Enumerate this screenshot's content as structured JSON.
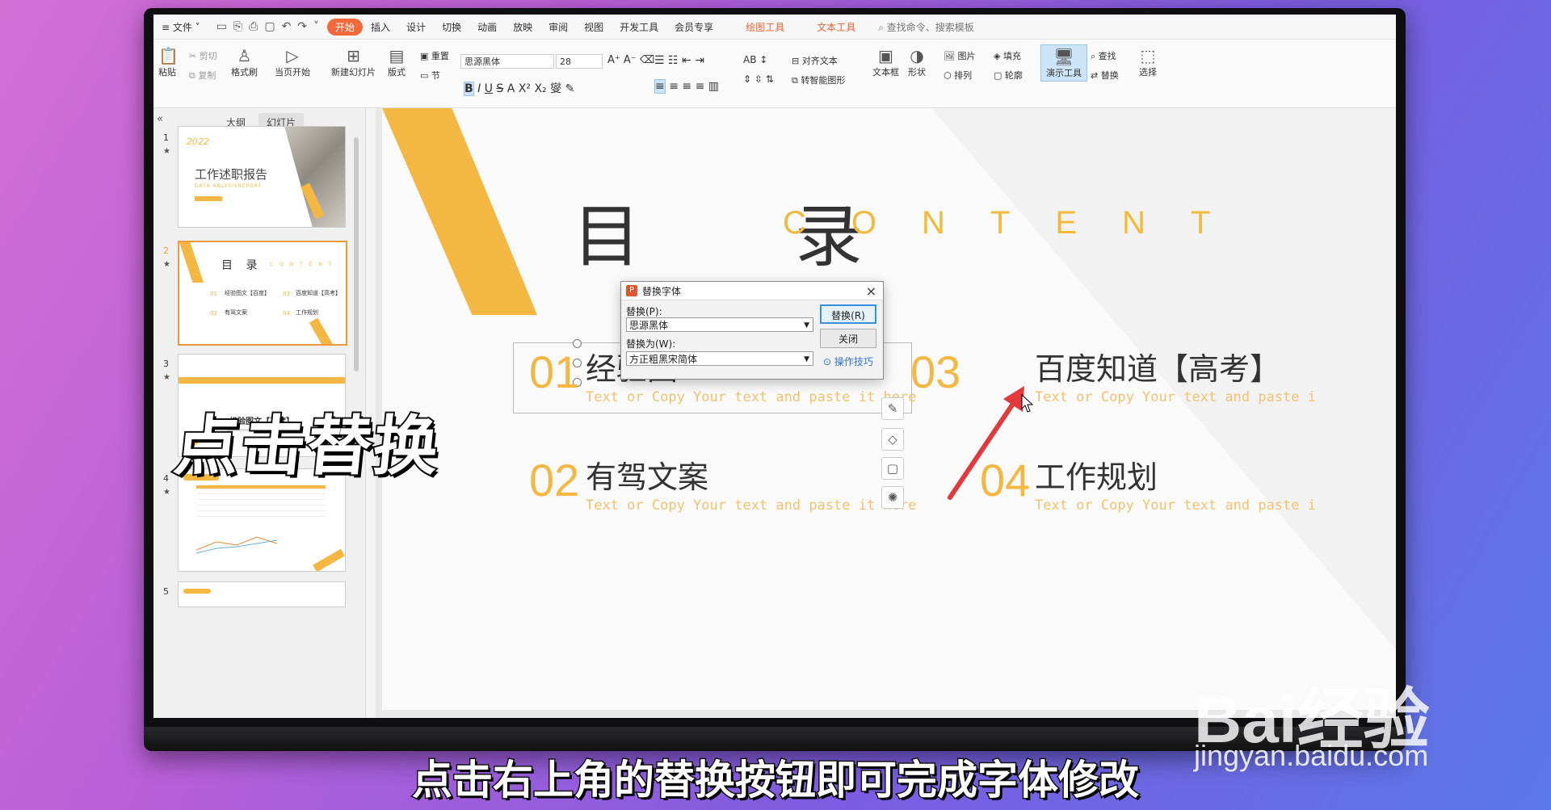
{
  "menubar": {
    "file": "≡ 文件 ˅",
    "tabs": [
      "开始",
      "插入",
      "设计",
      "切换",
      "动画",
      "放映",
      "审阅",
      "视图",
      "开发工具",
      "会员专享"
    ],
    "context_tabs": [
      "绘图工具",
      "文本工具"
    ],
    "search": "查找命令、搜索模板"
  },
  "ribbon": {
    "paste": "粘贴",
    "cut": "剪切",
    "copy": "复制",
    "format_painter": "格式刷",
    "from_current": "当页开始",
    "new_slide": "新建幻灯片",
    "layout": "版式",
    "reset": "重置",
    "section": "节",
    "font_name": "思源黑体",
    "font_size": "28",
    "align_text": "对齐文本",
    "smartart": "转智能图形",
    "textbox": "文本框",
    "shape": "形状",
    "picture": "图片",
    "arrange": "排列",
    "fill": "填充",
    "outline": "轮廓",
    "present_tools": "演示工具",
    "find": "查找",
    "replace": "替换",
    "select": "选择"
  },
  "panel": {
    "tab_outline": "大纲",
    "tab_slides": "幻灯片",
    "slide_numbers": [
      "1",
      "2",
      "3",
      "4",
      "5"
    ],
    "thumb1": {
      "year": "2022",
      "title": "工作述职报告",
      "sub": "DATA ANLYSISREPORT"
    },
    "thumb2": {
      "title": "目 录",
      "content": "C O N T E N T",
      "items": [
        "经验图文【百度】",
        "百度知道【高考】",
        "有驾文案",
        "工作规划"
      ],
      "nums": [
        "01",
        "03",
        "02",
        "04"
      ]
    },
    "thumb3": {
      "title": "经验图文【百度】"
    }
  },
  "slide": {
    "title": "目 录",
    "content": "CONTENT",
    "items": [
      {
        "num": "01",
        "title": "经验图",
        "text": "Text or Copy Your text and  paste it here"
      },
      {
        "num": "03",
        "title": "百度知道【高考】",
        "text": "Text or Copy Your text and  paste i"
      },
      {
        "num": "02",
        "title": "有驾文案",
        "text": "Text or Copy Your text and  paste it here"
      },
      {
        "num": "04",
        "title": "工作规划",
        "text": "Text or Copy Your text and  paste i"
      }
    ]
  },
  "dialog": {
    "title": "替换字体",
    "replace_label": "替换(P):",
    "replace_value": "思源黑体",
    "with_label": "替换为(W):",
    "with_value": "方正粗黑宋简体",
    "replace_button": "替换(R)",
    "close_button": "关闭",
    "tips": "操作技巧"
  },
  "overlay": {
    "headline": "点击替换",
    "caption": "点击右上角的替换按钮即可完成字体修改"
  },
  "watermark": {
    "brand": "Bai经验",
    "url": "jingyan.baidu.com"
  },
  "colors": {
    "accent": "#f4b842",
    "menu_active": "#f2693b",
    "dialog_button_border": "#3b8fe0",
    "arrow": "#e23a3a"
  }
}
